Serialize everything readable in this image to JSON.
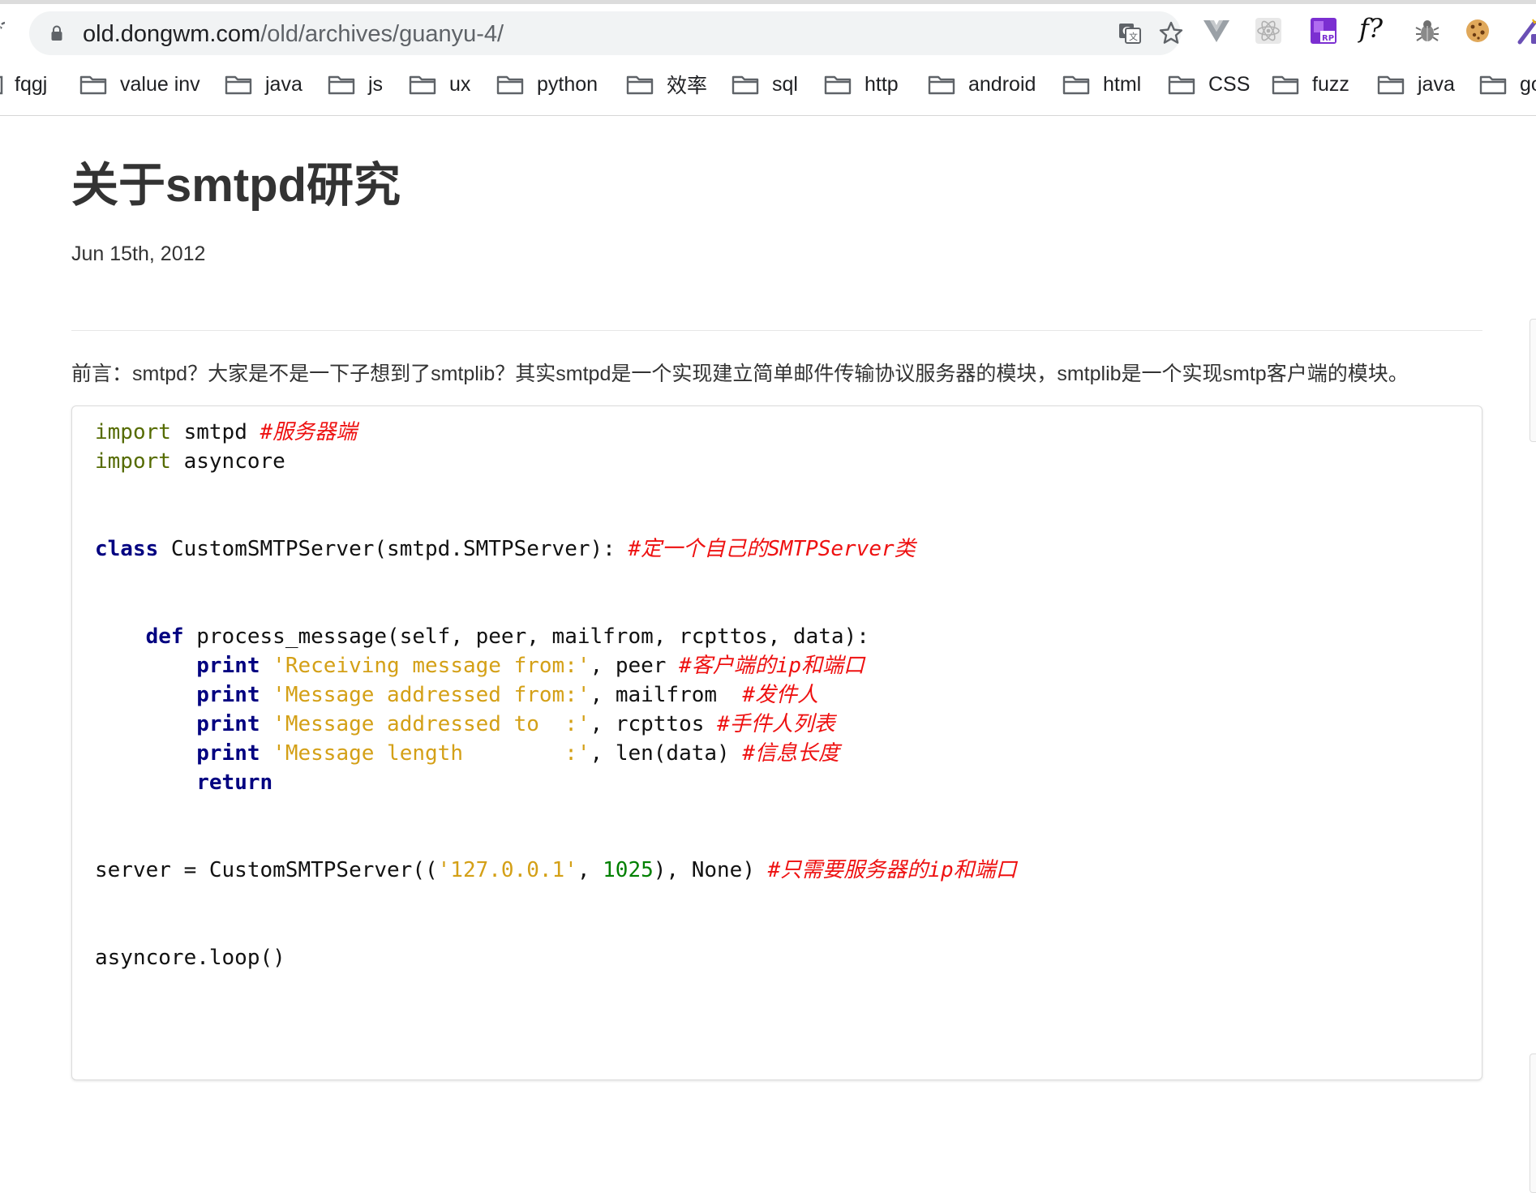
{
  "browser": {
    "url_host": "old.dongwm.com",
    "url_path": "/old/archives/guanyu-4/",
    "bookmarks": [
      {
        "label": "fqgj"
      },
      {
        "label": "value inv"
      },
      {
        "label": "java"
      },
      {
        "label": "js"
      },
      {
        "label": "ux"
      },
      {
        "label": "python"
      },
      {
        "label": "效率"
      },
      {
        "label": "sql"
      },
      {
        "label": "http"
      },
      {
        "label": "android"
      },
      {
        "label": "html"
      },
      {
        "label": "CSS"
      },
      {
        "label": "fuzz"
      },
      {
        "label": "java"
      },
      {
        "label": "go"
      }
    ],
    "extensions": [
      {
        "icon": "vue-devtools-icon"
      },
      {
        "icon": "react-devtools-icon"
      },
      {
        "icon": "rp-extension-icon"
      },
      {
        "icon": "function-extension-icon",
        "label": "f?"
      },
      {
        "icon": "bug-extension-icon"
      },
      {
        "icon": "cookie-extension-icon"
      },
      {
        "icon": "magic-wand-icon"
      }
    ]
  },
  "article": {
    "title": "关于smtpd研究",
    "date": "Jun 15th, 2012",
    "intro": "前言：smtpd？大家是不是一下子想到了smtplib？其实smtpd是一个实现建立简单邮件传输协议服务器的模块，smtplib是一个实现smtp客户端的模块。"
  },
  "code": {
    "lines": [
      [
        {
          "t": "import",
          "c": "imp"
        },
        {
          "t": " smtpd ",
          "c": "plain"
        },
        {
          "t": "#服务器端",
          "c": "com"
        }
      ],
      [
        {
          "t": "import",
          "c": "imp"
        },
        {
          "t": " asyncore",
          "c": "plain"
        }
      ],
      [],
      [],
      [
        {
          "t": "class",
          "c": "kw"
        },
        {
          "t": " CustomSMTPServer(smtpd.SMTPServer): ",
          "c": "plain"
        },
        {
          "t": "#定一个自己的SMTPServer类",
          "c": "com"
        }
      ],
      [],
      [],
      [
        {
          "t": "    ",
          "c": "plain"
        },
        {
          "t": "def",
          "c": "kw"
        },
        {
          "t": " process_message(self, peer, mailfrom, rcpttos, data):",
          "c": "plain"
        }
      ],
      [
        {
          "t": "        ",
          "c": "plain"
        },
        {
          "t": "print",
          "c": "kw"
        },
        {
          "t": " ",
          "c": "plain"
        },
        {
          "t": "'Receiving message from:'",
          "c": "str"
        },
        {
          "t": ", peer ",
          "c": "plain"
        },
        {
          "t": "#客户端的ip和端口",
          "c": "com"
        }
      ],
      [
        {
          "t": "        ",
          "c": "plain"
        },
        {
          "t": "print",
          "c": "kw"
        },
        {
          "t": " ",
          "c": "plain"
        },
        {
          "t": "'Message addressed from:'",
          "c": "str"
        },
        {
          "t": ", mailfrom  ",
          "c": "plain"
        },
        {
          "t": "#发件人",
          "c": "com"
        }
      ],
      [
        {
          "t": "        ",
          "c": "plain"
        },
        {
          "t": "print",
          "c": "kw"
        },
        {
          "t": " ",
          "c": "plain"
        },
        {
          "t": "'Message addressed to  :'",
          "c": "str"
        },
        {
          "t": ", rcpttos ",
          "c": "plain"
        },
        {
          "t": "#手件人列表",
          "c": "com"
        }
      ],
      [
        {
          "t": "        ",
          "c": "plain"
        },
        {
          "t": "print",
          "c": "kw"
        },
        {
          "t": " ",
          "c": "plain"
        },
        {
          "t": "'Message length        :'",
          "c": "str"
        },
        {
          "t": ", len(data) ",
          "c": "plain"
        },
        {
          "t": "#信息长度",
          "c": "com"
        }
      ],
      [
        {
          "t": "        ",
          "c": "plain"
        },
        {
          "t": "return",
          "c": "kw"
        }
      ],
      [],
      [],
      [
        {
          "t": "server = CustomSMTPServer((",
          "c": "plain"
        },
        {
          "t": "'127.0.0.1'",
          "c": "str"
        },
        {
          "t": ", ",
          "c": "plain"
        },
        {
          "t": "1025",
          "c": "num"
        },
        {
          "t": "), None) ",
          "c": "plain"
        },
        {
          "t": "#只需要服务器的ip和端口",
          "c": "com"
        }
      ],
      [],
      [],
      [
        {
          "t": "asyncore.loop()",
          "c": "plain"
        }
      ]
    ]
  },
  "colors": {
    "keyword": "#000080",
    "import": "#556b00",
    "string": "#d4a017",
    "number": "#008000",
    "comment": "#ee1111"
  }
}
